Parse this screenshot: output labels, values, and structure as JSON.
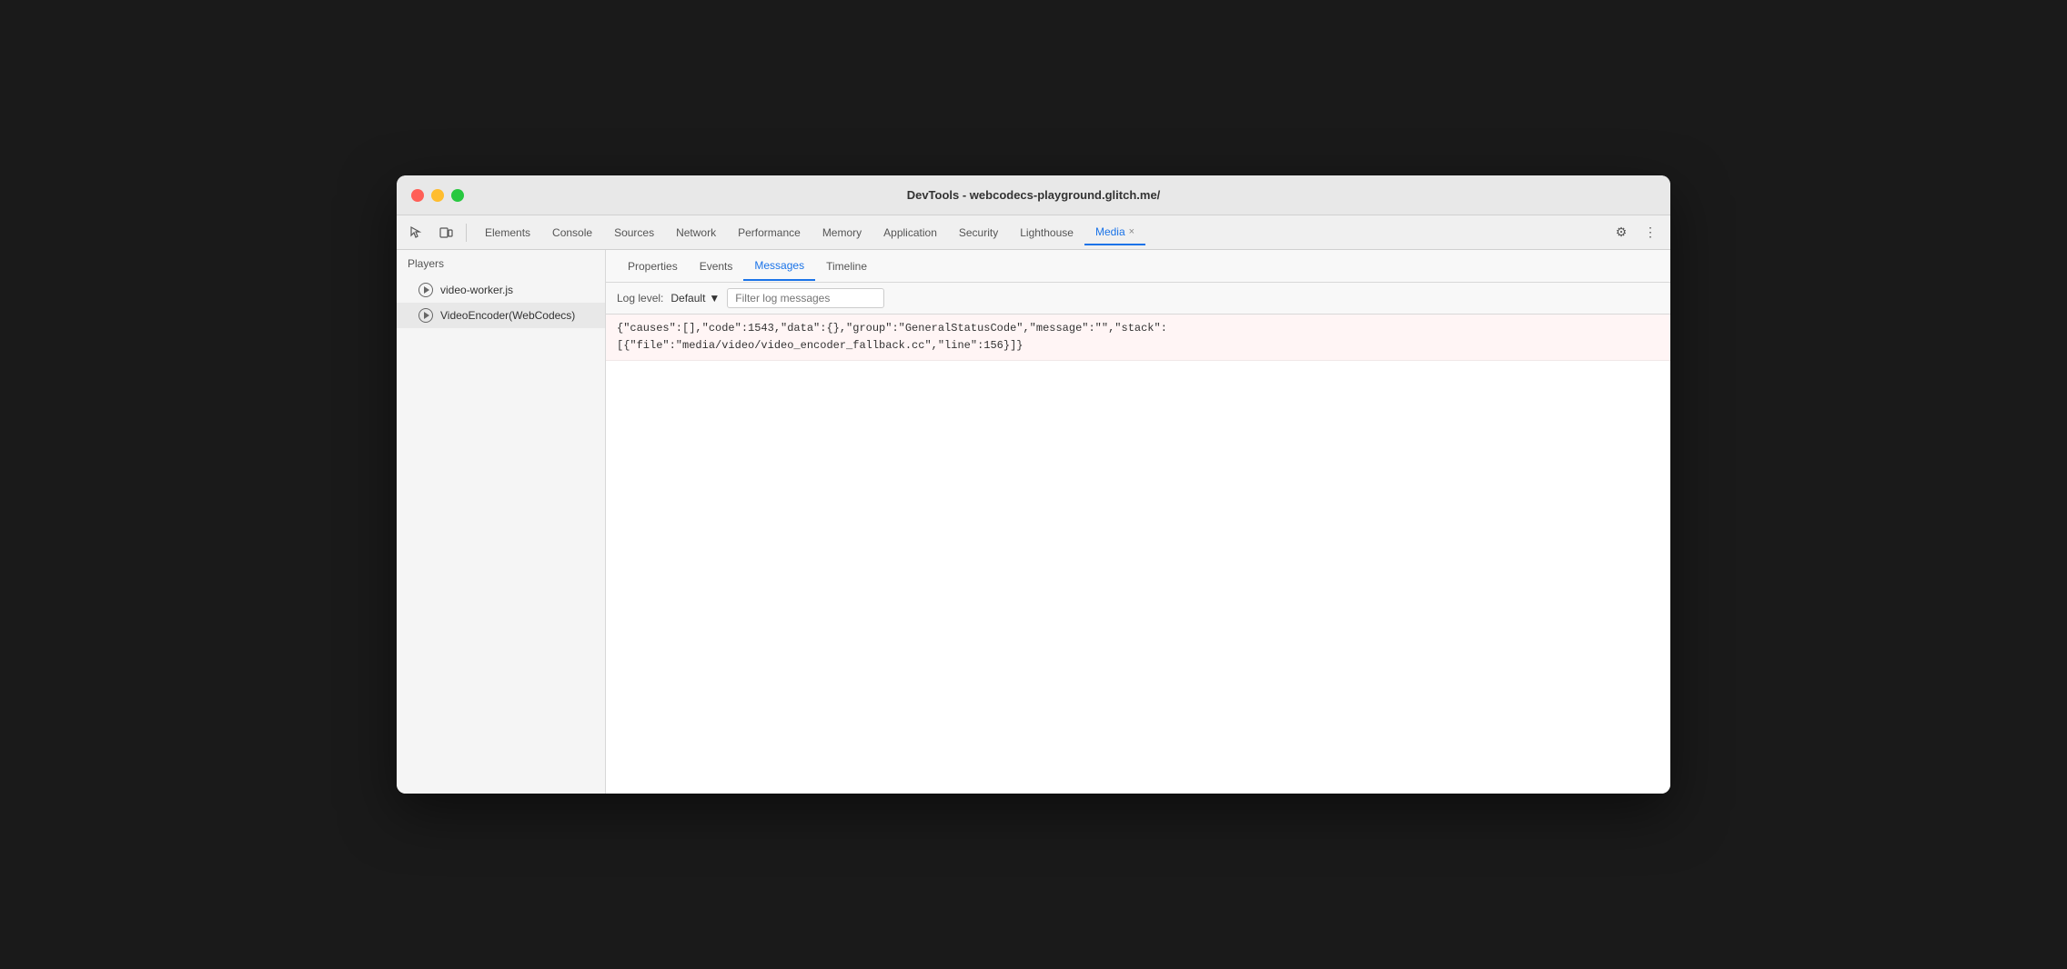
{
  "window": {
    "title": "DevTools - webcodecs-playground.glitch.me/"
  },
  "traffic_lights": {
    "red_label": "close",
    "yellow_label": "minimize",
    "green_label": "maximize"
  },
  "toolbar": {
    "inspect_icon": "⬚",
    "device_icon": "▱",
    "tabs": [
      {
        "id": "elements",
        "label": "Elements",
        "active": false
      },
      {
        "id": "console",
        "label": "Console",
        "active": false
      },
      {
        "id": "sources",
        "label": "Sources",
        "active": false
      },
      {
        "id": "network",
        "label": "Network",
        "active": false
      },
      {
        "id": "performance",
        "label": "Performance",
        "active": false
      },
      {
        "id": "memory",
        "label": "Memory",
        "active": false
      },
      {
        "id": "application",
        "label": "Application",
        "active": false
      },
      {
        "id": "security",
        "label": "Security",
        "active": false
      },
      {
        "id": "lighthouse",
        "label": "Lighthouse",
        "active": false
      },
      {
        "id": "media",
        "label": "Media",
        "active": true
      }
    ],
    "media_close": "×",
    "settings_icon": "⚙",
    "more_icon": "⋮"
  },
  "sidebar": {
    "header": "Players",
    "players": [
      {
        "id": "video-worker",
        "label": "video-worker.js",
        "selected": false
      },
      {
        "id": "video-encoder",
        "label": "VideoEncoder(WebCodecs)",
        "selected": true
      }
    ]
  },
  "panel": {
    "tabs": [
      {
        "id": "properties",
        "label": "Properties",
        "active": false
      },
      {
        "id": "events",
        "label": "Events",
        "active": false
      },
      {
        "id": "messages",
        "label": "Messages",
        "active": true
      },
      {
        "id": "timeline",
        "label": "Timeline",
        "active": false
      }
    ],
    "toolbar": {
      "log_level_label": "Log level:",
      "log_level_value": "Default",
      "log_level_arrow": "▼",
      "filter_placeholder": "Filter log messages"
    },
    "log_entries": [
      {
        "id": "entry-1",
        "text": "{\"causes\":[],\"code\":1543,\"data\":{},\"group\":\"GeneralStatusCode\",\"message\":\"\",\"stack\":\n[{\"file\":\"media/video/video_encoder_fallback.cc\",\"line\":156}]}"
      }
    ]
  }
}
